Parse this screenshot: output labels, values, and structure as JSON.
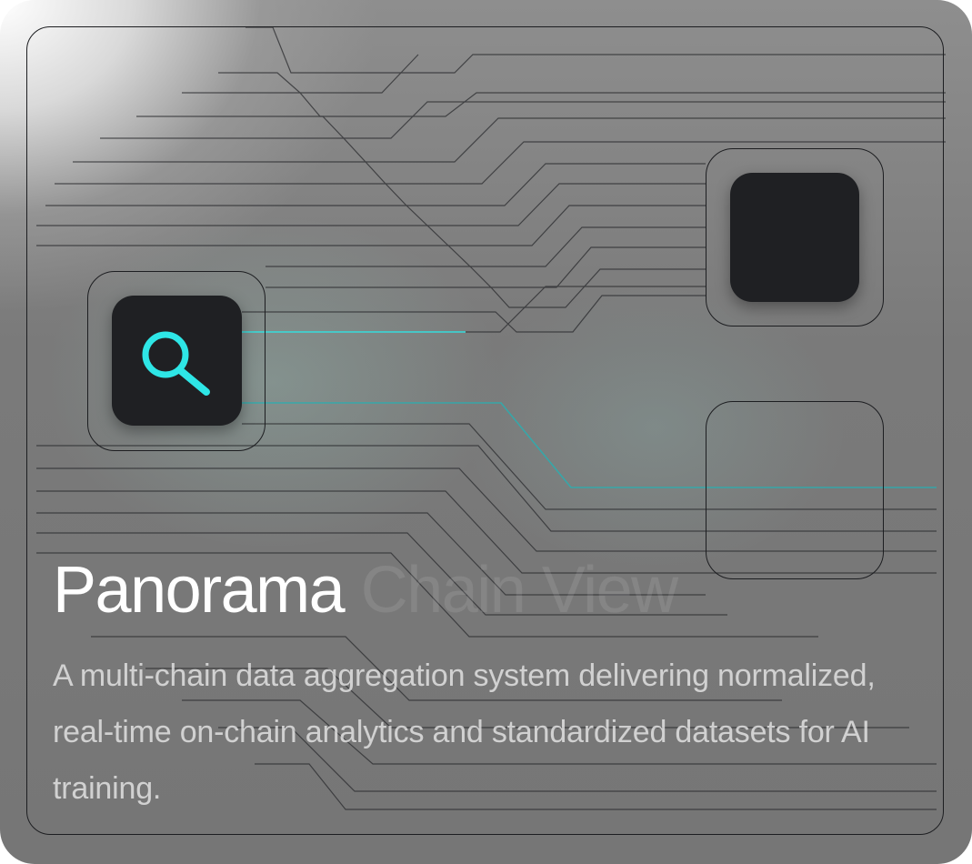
{
  "card": {
    "title_primary": "Panorama",
    "title_secondary": "Chain View",
    "description": "A multi-chain data aggregation system delivering normalized, real-time on-chain analytics and standardized datasets for AI training."
  },
  "icons": {
    "search": "search-icon"
  },
  "colors": {
    "accent": "#2ee6e6",
    "chip": "#1f2023",
    "line": "#1d1e21"
  }
}
